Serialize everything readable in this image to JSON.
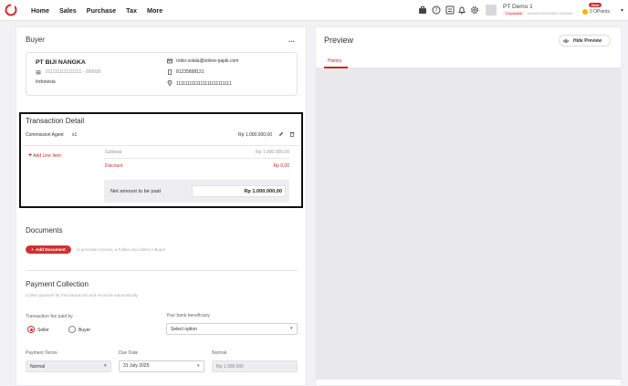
{
  "nav": {
    "items": [
      "Home",
      "Sales",
      "Purchase",
      "Tax",
      "More"
    ]
  },
  "top_icons": [
    "briefcase-icon",
    "help-icon",
    "calculator-icon",
    "bell-icon",
    "gear-icon"
  ],
  "company": {
    "name": "PT Demo 1",
    "badge": "Corporate",
    "id": "1899090909090921-000000"
  },
  "points": {
    "badge": "New",
    "label": "0 OPoints"
  },
  "buyer": {
    "title": "Buyer",
    "menu": "...",
    "name": "PT BIJI NANGKA",
    "npwp": "0111111111111111 - 000000",
    "country": "Indonesia",
    "email": "robin.solala@online-pajak.com",
    "phone": "81235898121",
    "address": "1111111111111111111111111"
  },
  "transaction": {
    "title": "Transaction Detail",
    "item_name": "Commission Agent",
    "item_qty": "x1",
    "item_amount": "Rp 1.000.000,00",
    "add_line": "Add Line Item",
    "subtotal_label": "Subtotal",
    "subtotal_value": "Rp 1.000.000,00",
    "discount_label": "Discount",
    "discount_value": "Rp 0,00",
    "net_label": "Net amount to be paid",
    "net_value": "Rp 1.000.000,00"
  },
  "documents": {
    "title": "Documents",
    "add_button": "Add Document",
    "hint": "to generate invoices, e-Faktur and collect e-Bupot"
  },
  "payment": {
    "title": "Payment Collection",
    "subtitle": "Collect payment for this transaction and reconcile automatically",
    "fee_label": "Transaction fee paid by",
    "fee_options": [
      "Seller",
      "Buyer"
    ],
    "bank_label": "Your bank beneficiary",
    "bank_placeholder": "Select option",
    "terms_label": "Payment Terms",
    "terms_value": "Normal",
    "due_label": "Due Date",
    "due_value": "31 July 2025",
    "normal_label": "Normal",
    "normal_value": "Rp 1.000.000"
  },
  "preview": {
    "title": "Preview",
    "hide_button": "Hide Preview",
    "tab": "History"
  },
  "colors": {
    "accent": "#d32f2f",
    "preview_bg": "#e9e9ec"
  }
}
